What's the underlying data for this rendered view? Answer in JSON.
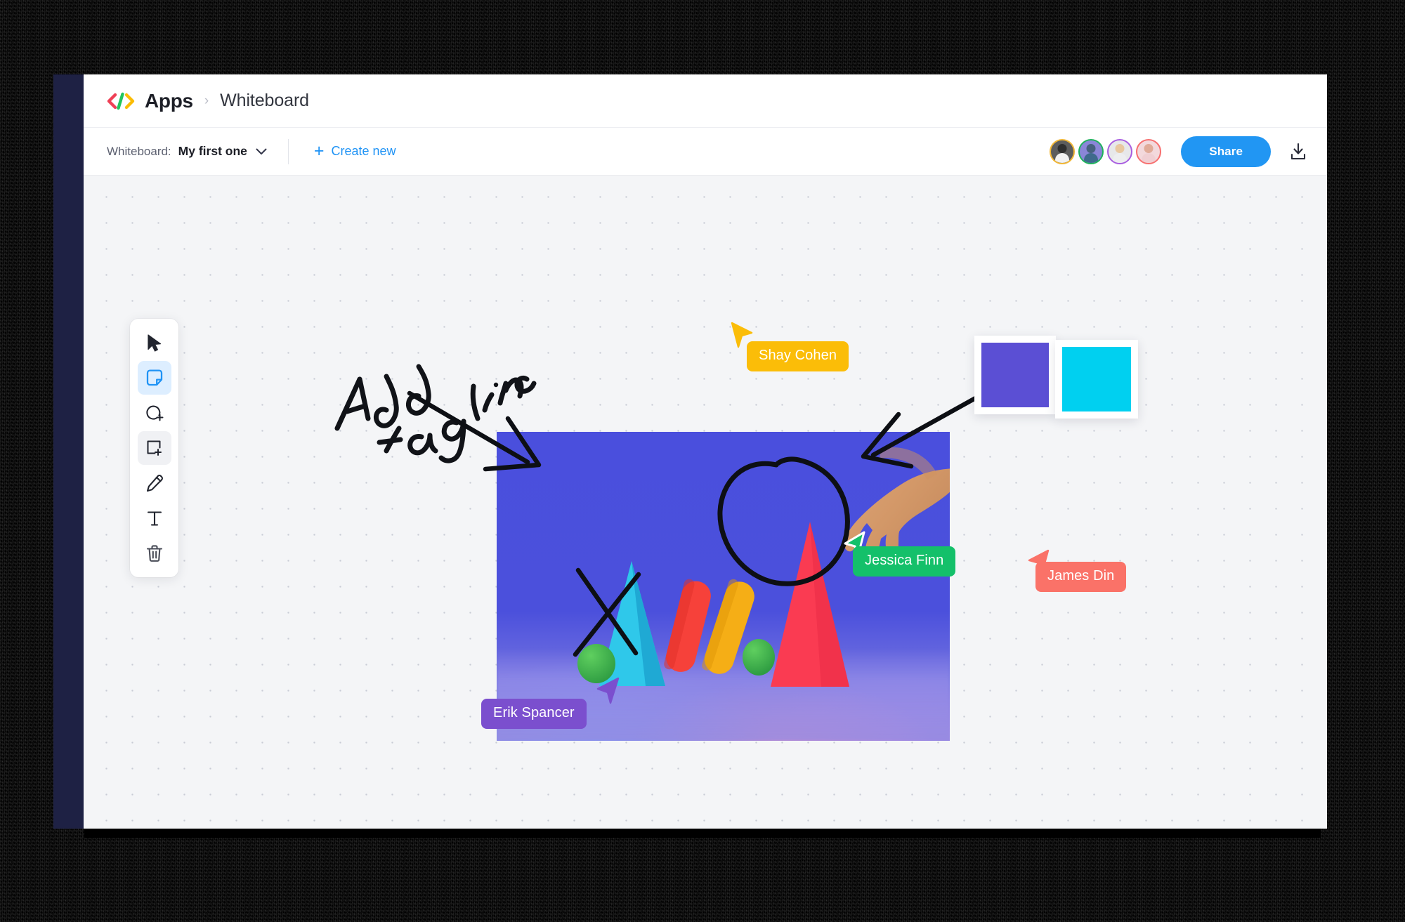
{
  "window": {
    "rail_color": "#1e2144"
  },
  "header": {
    "logo_icon": "code-brackets-logo",
    "logo_colors": [
      "#ef4056",
      "#22c55e",
      "#fbbc04"
    ],
    "brand": "Apps",
    "separator": "›",
    "current": "Whiteboard"
  },
  "toolbar": {
    "whiteboard_label": "Whiteboard:",
    "whiteboard_value": "My first one",
    "caret_icon": "chevron-down-icon",
    "create_new_label": "Create new",
    "create_new_icon": "plus-icon",
    "share_label": "Share",
    "download_icon": "download-icon",
    "accent_blue": "#2196f3",
    "link_blue": "#1f93f5",
    "collaborators": [
      {
        "name": "Shay Cohen",
        "ring": "#f2b736",
        "skin": "#3a3a3a",
        "shirt": "#f0f0f0"
      },
      {
        "name": "Jessica Finn",
        "ring": "#1fb35c",
        "skin": "#5c7fa8",
        "shirt": "#6f6fc8"
      },
      {
        "name": "Erik Spancer",
        "ring": "#a95ee0",
        "skin": "#e8c79f",
        "shirt": "#edeef0"
      },
      {
        "name": "James Din",
        "ring": "#f76f6f",
        "skin": "#e5b9a8",
        "shirt": "#f3d9dc"
      }
    ]
  },
  "tools": [
    {
      "name": "select-tool",
      "icon": "cursor-arrow-icon",
      "state": "default"
    },
    {
      "name": "sticky-note-tool",
      "icon": "sticky-note-icon",
      "state": "active"
    },
    {
      "name": "add-circle-tool",
      "icon": "circle-plus-icon",
      "state": "default"
    },
    {
      "name": "add-frame-tool",
      "icon": "square-plus-icon",
      "state": "hover"
    },
    {
      "name": "pencil-tool",
      "icon": "pencil-icon",
      "state": "default"
    },
    {
      "name": "text-tool",
      "icon": "text-t-icon",
      "state": "default"
    },
    {
      "name": "delete-tool",
      "icon": "trash-icon",
      "state": "default"
    }
  ],
  "canvas": {
    "background": "#f4f5f7",
    "dot_color": "#c9ccd6",
    "handwriting": {
      "line1": "Add",
      "line2": "tagline"
    },
    "ink_annotations": [
      "arrow-pointing-right-into-photo",
      "arrow-pointing-left-into-photo",
      "circle-around-hand",
      "x-mark-over-green-sphere"
    ]
  },
  "photo": {
    "alt": "geometric paper shapes on blue backdrop with hand",
    "backdrop_color": "#4b50dc",
    "objects": [
      {
        "shape": "cyan-triangle",
        "color": "#25c2e8"
      },
      {
        "shape": "red-capsule",
        "color": "#f6413a"
      },
      {
        "shape": "yellow-capsule",
        "color": "#f5ae16"
      },
      {
        "shape": "green-sphere-left",
        "color": "#3fb34f"
      },
      {
        "shape": "green-sphere-right",
        "color": "#3fb34f"
      },
      {
        "shape": "red-cone",
        "color": "#fa3b52"
      },
      {
        "shape": "hand",
        "color": "#d99b6c"
      }
    ]
  },
  "nametags": [
    {
      "name": "Shay Cohen",
      "color": "#fbbd08",
      "text_color": "#ffffff"
    },
    {
      "name": "Jessica Finn",
      "color": "#14c06a",
      "text_color": "#ffffff"
    },
    {
      "name": "James Din",
      "color": "#fa7268",
      "text_color": "#ffffff"
    },
    {
      "name": "Erik Spancer",
      "color": "#7b4fce",
      "text_color": "#ffffff"
    }
  ],
  "swatches": [
    {
      "name": "purple-swatch",
      "color": "#5b4fd4"
    },
    {
      "name": "cyan-swatch",
      "color": "#00d0f0"
    }
  ]
}
